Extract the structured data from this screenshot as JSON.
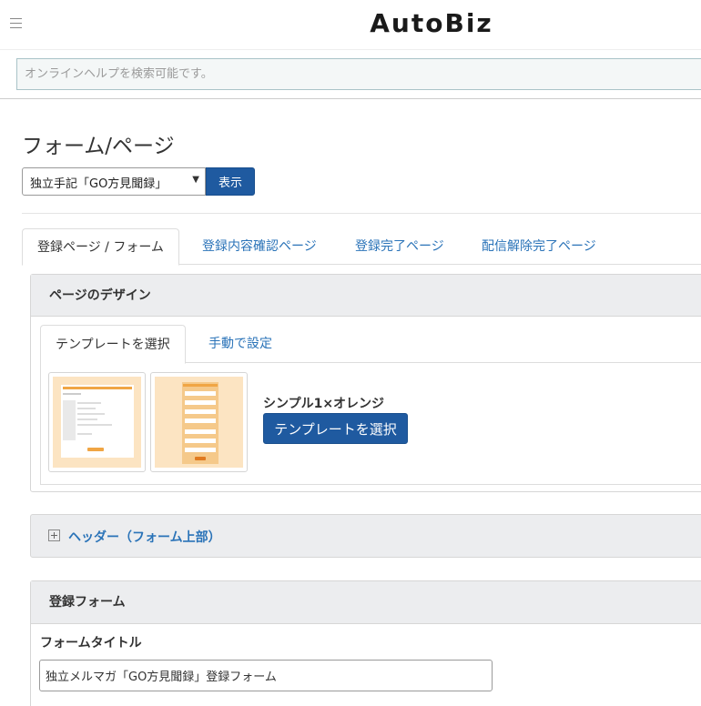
{
  "app": {
    "logo": "AutoBiz"
  },
  "search": {
    "placeholder": "オンラインヘルプを検索可能です。"
  },
  "page": {
    "title": "フォーム/ページ"
  },
  "selector": {
    "selected": "独立手記「GO方見聞録」",
    "show_label": "表示"
  },
  "tabs": [
    {
      "label": "登録ページ / フォーム",
      "active": true
    },
    {
      "label": "登録内容確認ページ",
      "active": false
    },
    {
      "label": "登録完了ページ",
      "active": false
    },
    {
      "label": "配信解除完了ページ",
      "active": false
    }
  ],
  "design_panel": {
    "heading": "ページのデザイン",
    "subtabs": [
      {
        "label": "テンプレートを選択",
        "active": true
      },
      {
        "label": "手動で設定",
        "active": false
      }
    ],
    "selected_template_name": "シンプル1×オレンジ",
    "select_template_button": "テンプレートを選択",
    "colors": {
      "template_bg": "#fce4c2",
      "template_accent": "#f0a544"
    }
  },
  "header_section": {
    "label": "ヘッダー（フォーム上部）"
  },
  "form_panel": {
    "heading": "登録フォーム",
    "form_title_label": "フォームタイトル",
    "form_title_value": "独立メルマガ「GO方見聞録」登録フォーム"
  },
  "colors": {
    "primary": "#1f5aa0",
    "link": "#2a73b8",
    "panel_header": "#ecedef"
  }
}
